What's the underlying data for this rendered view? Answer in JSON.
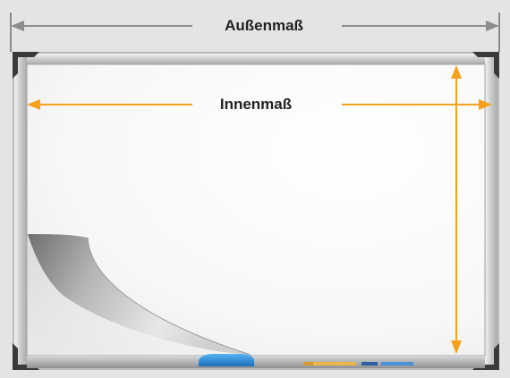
{
  "labels": {
    "outer_dimension": "Außenmaß",
    "inner_dimension": "Innenmaß"
  },
  "colors": {
    "background": "#e4e4e4",
    "outer_arrow": "#8c8c8c",
    "inner_arrow": "#f5a11c",
    "frame": "#c8cacc",
    "frame_corner": "#3a3a3a",
    "board_surface": "#ffffff",
    "eraser": "#1f8fe0",
    "text": "#222222"
  },
  "icons": {
    "corner": "frame-corner-icon",
    "page_curl": "page-curl-icon",
    "eraser": "eraser-icon",
    "marker": "marker-icon"
  }
}
